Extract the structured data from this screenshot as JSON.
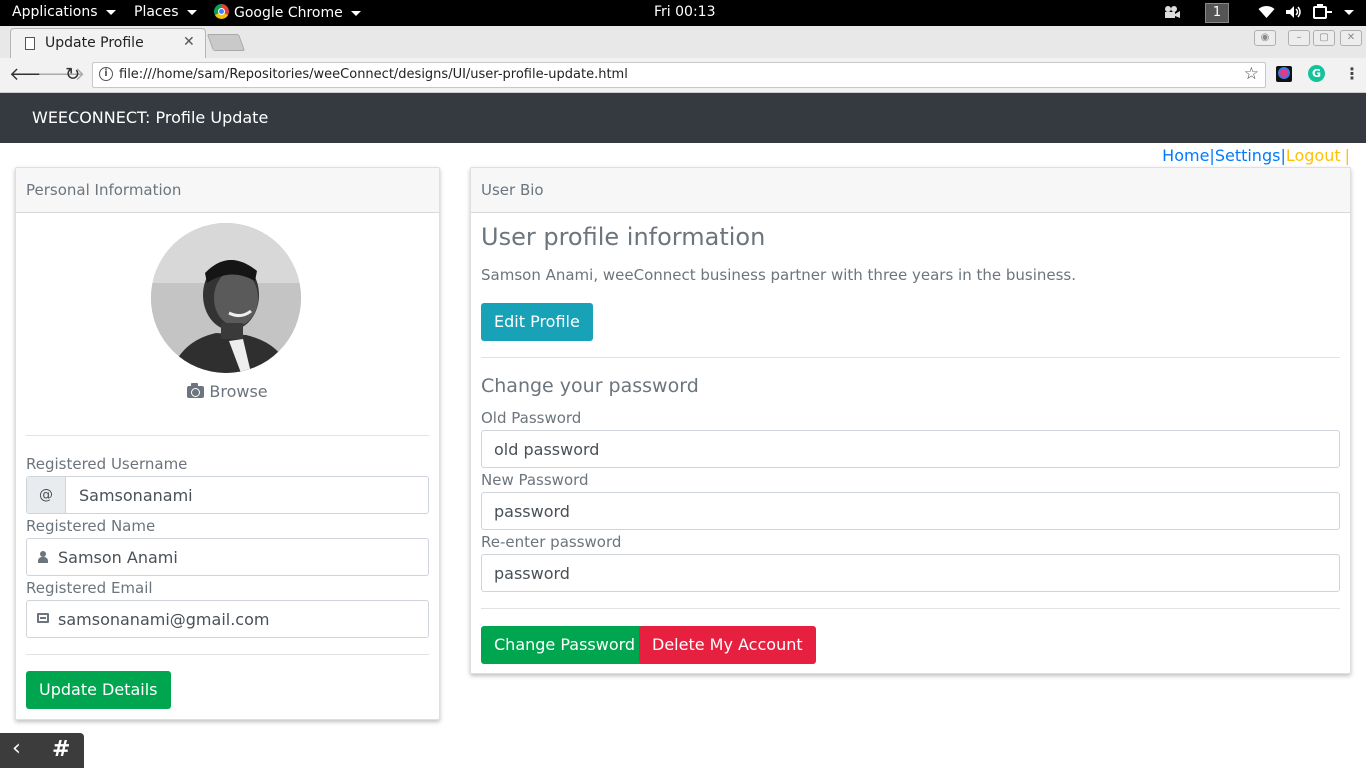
{
  "gnome": {
    "applications": "Applications",
    "places": "Places",
    "browser": "Google Chrome",
    "clock": "Fri 00:13",
    "workspace": "1"
  },
  "browser": {
    "tab_title": "Update Profile",
    "url": "file:///home/sam/Repositories/weeConnect/designs/UI/user-profile-update.html"
  },
  "navbar": {
    "brand": "WEECONNECT: Profile Update"
  },
  "toplinks": {
    "home": "Home",
    "settings": "Settings",
    "logout": "Logout",
    "sep": "|"
  },
  "personal": {
    "header": "Personal Information",
    "browse": "Browse",
    "username_label": "Registered Username",
    "username_addon": "@",
    "username_value": "Samsonanami",
    "name_label": "Registered Name",
    "name_value": "Samson Anami",
    "email_label": "Registered Email",
    "email_value": "samsonanami@gmail.com",
    "update_button": "Update Details"
  },
  "bio": {
    "header": "User Bio",
    "title": "User profile information",
    "text": "Samson Anami, weeConnect business partner with three years in the business.",
    "edit_button": "Edit Profile",
    "pw_title": "Change your password",
    "old_label": "Old Password",
    "old_placeholder": "old password",
    "new_label": "New Password",
    "new_placeholder": "password",
    "reenter_label": "Re-enter password",
    "reenter_placeholder": "password",
    "change_button": "Change Password",
    "delete_button": "Delete My Account"
  },
  "colors": {
    "navbar": "#343a40",
    "success": "#00a64f",
    "info": "#17a2b8",
    "danger": "#e8203f",
    "link": "#007bff",
    "warning": "#ffc107"
  }
}
